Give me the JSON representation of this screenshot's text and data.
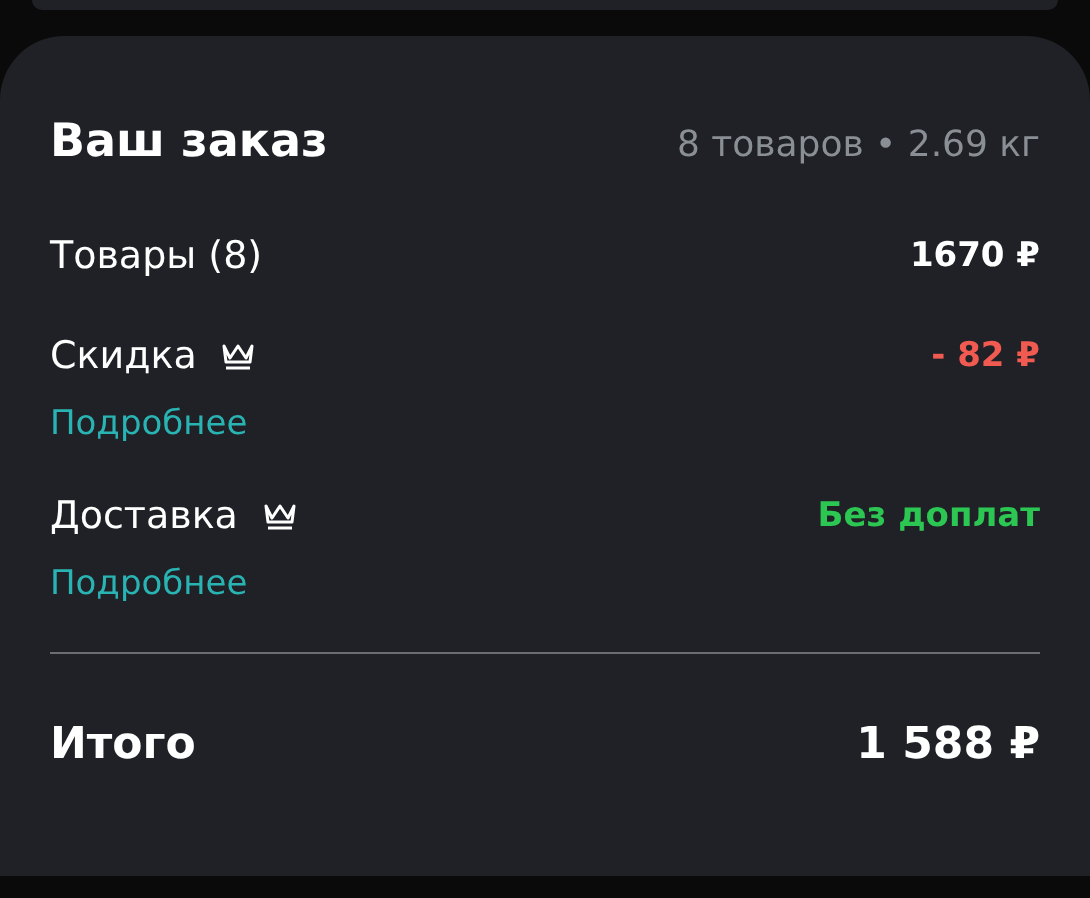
{
  "order": {
    "title": "Ваш заказ",
    "summary": "8 товаров • 2.69 кг"
  },
  "rows": [
    {
      "label": "Товары (8)",
      "premium": false,
      "value": "1670 ₽",
      "color": "#ffffff"
    },
    {
      "label": "Скидка",
      "premium": true,
      "value": "- 82 ₽",
      "color": "#f05a50",
      "link": "Подробнее"
    },
    {
      "label": "Доставка",
      "premium": true,
      "value": "Без доплат",
      "color": "#2cc653",
      "link": "Подробнее"
    }
  ],
  "total": {
    "label": "Итого",
    "value": "1 588 ₽"
  }
}
